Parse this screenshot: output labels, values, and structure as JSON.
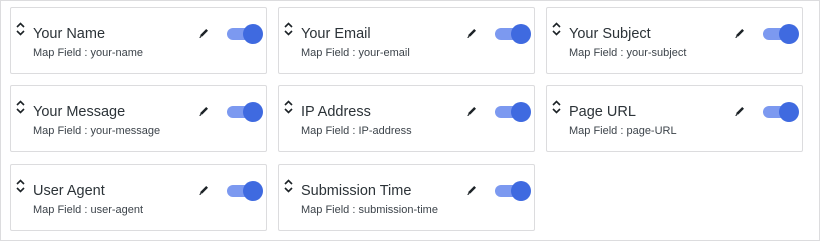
{
  "map_field_prefix": "Map Field : ",
  "accent_color": "#3f6ae0",
  "fields": [
    {
      "title": "Your Name",
      "map_field": "Map Field : your-name",
      "enabled": true
    },
    {
      "title": "Your Email",
      "map_field": "Map Field : your-email",
      "enabled": true
    },
    {
      "title": "Your Subject",
      "map_field": "Map Field : your-subject",
      "enabled": true
    },
    {
      "title": "Your Message",
      "map_field": "Map Field : your-message",
      "enabled": true
    },
    {
      "title": "IP Address",
      "map_field": "Map Field : IP-address",
      "enabled": true
    },
    {
      "title": "Page URL",
      "map_field": "Map Field : page-URL",
      "enabled": true
    },
    {
      "title": "User Agent",
      "map_field": "Map Field : user-agent",
      "enabled": true
    },
    {
      "title": "Submission Time",
      "map_field": "Map Field : submission-time",
      "enabled": true
    }
  ]
}
